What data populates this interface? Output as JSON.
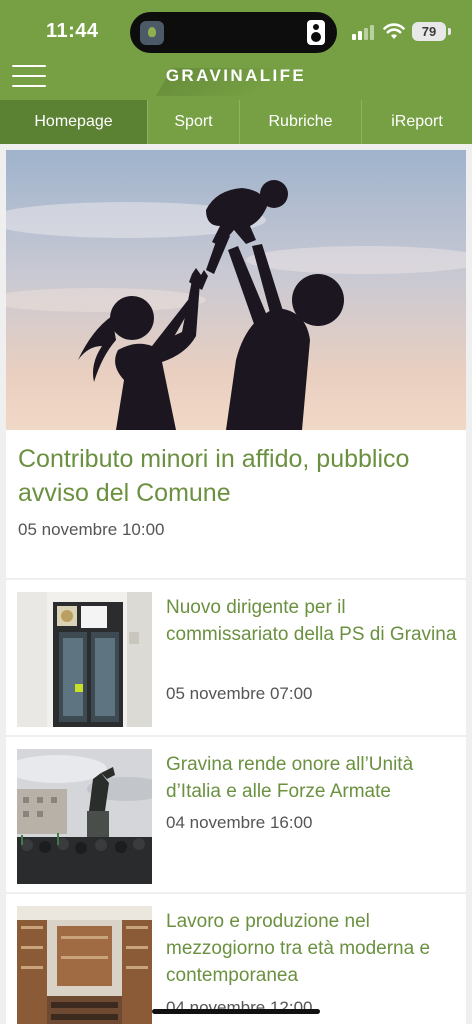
{
  "status_bar": {
    "time": "11:44",
    "battery": "79"
  },
  "header": {
    "logo": "GRAVINALIFE"
  },
  "tabs": [
    {
      "label": "Homepage",
      "active": true
    },
    {
      "label": "Sport",
      "active": false
    },
    {
      "label": "Rubriche",
      "active": false
    },
    {
      "label": "iReport",
      "active": false
    }
  ],
  "hero": {
    "title": "Contributo minori in affido, pubblico avviso del Comune",
    "date": "05 novembre 10:00"
  },
  "articles": [
    {
      "title": "Nuovo dirigente per il commissariato della PS di Gravina",
      "date": "05 novembre 07:00"
    },
    {
      "title": "Gravina rende onore all’Unità d’Italia e alle Forze Armate",
      "date": "04 novembre 16:00"
    },
    {
      "title": "Lavoro e produzione nel mezzogiorno tra età moderna e contemporanea",
      "date": "04 novembre 12:00"
    }
  ],
  "colors": {
    "brand_green": "#76a043",
    "active_tab": "#5b8132",
    "headline": "#6b9140"
  }
}
